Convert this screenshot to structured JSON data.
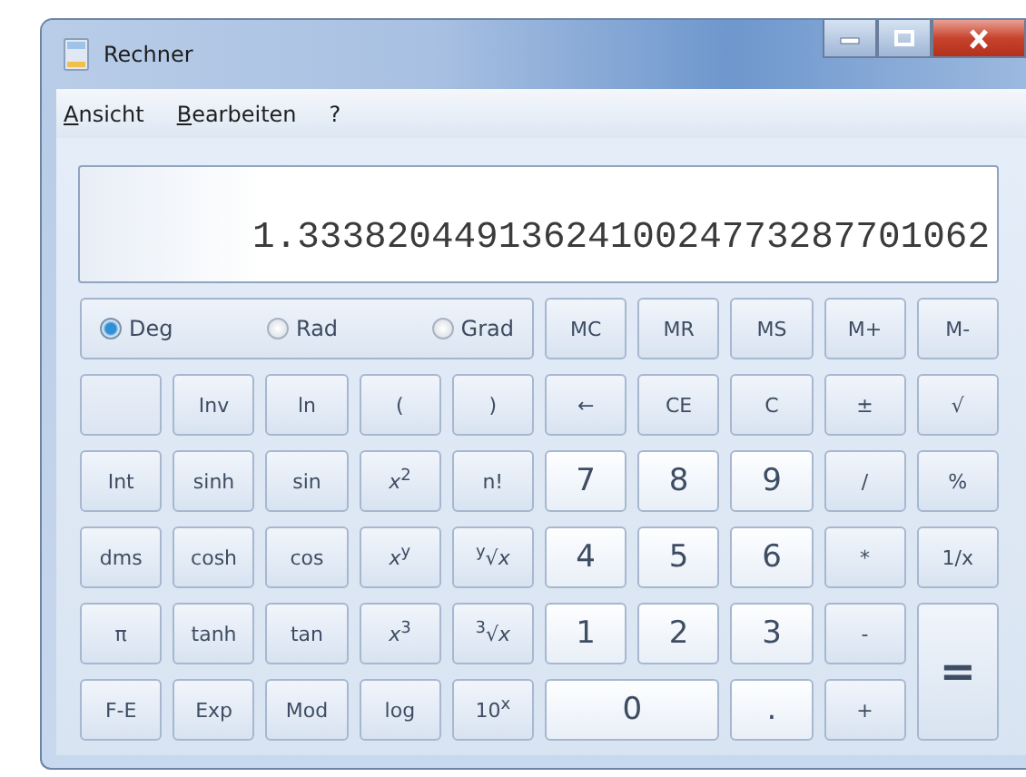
{
  "window": {
    "title": "Rechner"
  },
  "menu": [
    {
      "label": "Ansicht"
    },
    {
      "label": "Bearbeiten"
    },
    {
      "label": "?"
    }
  ],
  "display": {
    "value": "1.3338204491362410024773287701062"
  },
  "angle_modes": [
    {
      "label": "Deg",
      "selected": true
    },
    {
      "label": "Rad",
      "selected": false
    },
    {
      "label": "Grad",
      "selected": false
    }
  ],
  "keys": [
    {
      "label": "MC",
      "kind": "fn"
    },
    {
      "label": "MR",
      "kind": "fn"
    },
    {
      "label": "MS",
      "kind": "fn"
    },
    {
      "label": "M+",
      "kind": "fn"
    },
    {
      "label": "M-",
      "kind": "fn"
    },
    {
      "kind": "blank"
    },
    {
      "label": "Inv",
      "kind": "fn"
    },
    {
      "label": "ln",
      "kind": "fn"
    },
    {
      "label": "(",
      "kind": "fn"
    },
    {
      "label": ")",
      "kind": "fn"
    },
    {
      "label": "←",
      "kind": "fn"
    },
    {
      "label": "CE",
      "kind": "fn"
    },
    {
      "label": "C",
      "kind": "fn"
    },
    {
      "label": "±",
      "kind": "fn"
    },
    {
      "label": "√",
      "kind": "fn"
    },
    {
      "label": "Int",
      "kind": "fn"
    },
    {
      "label": "sinh",
      "kind": "fn"
    },
    {
      "label": "sin",
      "kind": "fn"
    },
    {
      "label": "*x*$^{2}$",
      "kind": "fn"
    },
    {
      "label": "n!",
      "kind": "fn"
    },
    {
      "label": "7",
      "kind": "digit"
    },
    {
      "label": "8",
      "kind": "digit"
    },
    {
      "label": "9",
      "kind": "digit"
    },
    {
      "label": "/",
      "kind": "fn"
    },
    {
      "label": "%",
      "kind": "fn"
    },
    {
      "label": "dms",
      "kind": "fn"
    },
    {
      "label": "cosh",
      "kind": "fn"
    },
    {
      "label": "cos",
      "kind": "fn"
    },
    {
      "label": "*x*$^{y}$",
      "kind": "fn"
    },
    {
      "label": "$^{y}$√*x*",
      "kind": "fn"
    },
    {
      "label": "4",
      "kind": "digit"
    },
    {
      "label": "5",
      "kind": "digit"
    },
    {
      "label": "6",
      "kind": "digit"
    },
    {
      "label": "*",
      "kind": "fn"
    },
    {
      "label": "1/x",
      "kind": "fn"
    },
    {
      "label": "π",
      "kind": "fn"
    },
    {
      "label": "tanh",
      "kind": "fn"
    },
    {
      "label": "tan",
      "kind": "fn"
    },
    {
      "label": "*x*$^{3}$",
      "kind": "fn"
    },
    {
      "label": "$^{3}$√*x*",
      "kind": "fn"
    },
    {
      "label": "1",
      "kind": "digit"
    },
    {
      "label": "2",
      "kind": "digit"
    },
    {
      "label": "3",
      "kind": "digit"
    },
    {
      "label": "-",
      "kind": "fn"
    },
    {
      "label": "=",
      "kind": "tall"
    },
    {
      "label": "F-E",
      "kind": "fn"
    },
    {
      "label": "Exp",
      "kind": "fn"
    },
    {
      "label": "Mod",
      "kind": "fn"
    },
    {
      "label": "log",
      "kind": "fn"
    },
    {
      "label": "10$^{x}$",
      "kind": "fn"
    },
    {
      "label": "0",
      "kind": "wide"
    },
    {
      "label": ".",
      "kind": "digit"
    },
    {
      "label": "+",
      "kind": "fn"
    }
  ]
}
